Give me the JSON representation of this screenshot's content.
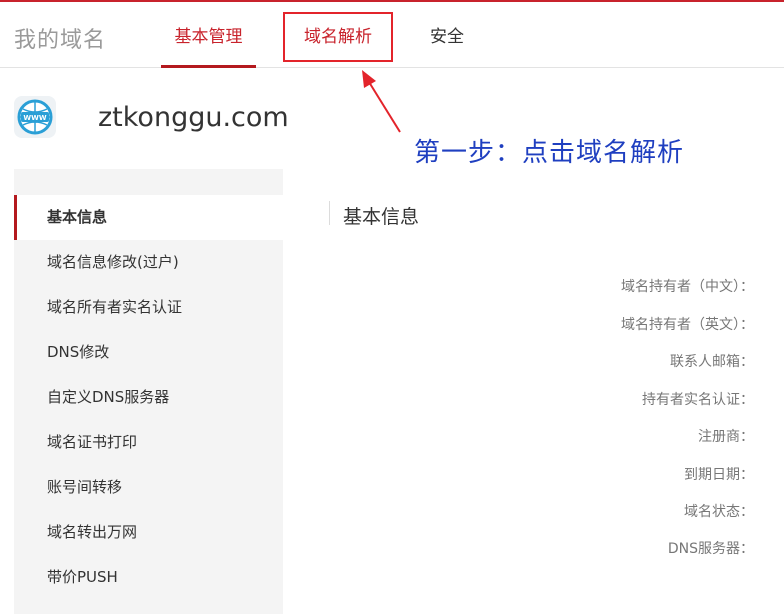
{
  "header": {
    "title": "我的域名",
    "tabs": [
      {
        "label": "基本管理"
      },
      {
        "label": "域名解析"
      },
      {
        "label": "安全"
      }
    ]
  },
  "domain": {
    "icon": "www-globe-icon",
    "name": "ztkonggu.com"
  },
  "annotation": {
    "text": "第一步：点击域名解析",
    "color": "#1f3fc0"
  },
  "sidebar": {
    "items": [
      {
        "label": "基本信息"
      },
      {
        "label": "域名信息修改(过户)"
      },
      {
        "label": "域名所有者实名认证"
      },
      {
        "label": "DNS修改"
      },
      {
        "label": "自定义DNS服务器"
      },
      {
        "label": "域名证书打印"
      },
      {
        "label": "账号间转移"
      },
      {
        "label": "域名转出万网"
      },
      {
        "label": "带价PUSH"
      }
    ]
  },
  "main": {
    "section_title": "基本信息",
    "fields": [
      {
        "label": "域名持有者（中文）："
      },
      {
        "label": "域名持有者（英文）："
      },
      {
        "label": "联系人邮箱："
      },
      {
        "label": "持有者实名认证："
      },
      {
        "label": "注册商："
      },
      {
        "label": "到期日期："
      },
      {
        "label": "域名状态："
      },
      {
        "label": "DNS服务器："
      }
    ]
  },
  "colors": {
    "brand_red": "#c8232c",
    "highlight_red": "#e3242b",
    "annotation_blue": "#1f3fc0"
  }
}
